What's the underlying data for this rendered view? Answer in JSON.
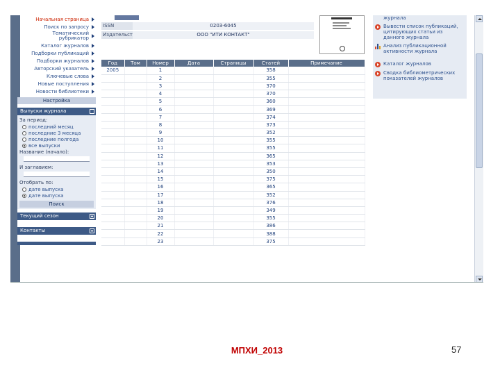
{
  "nav": {
    "links": [
      {
        "label": "Начальная страница",
        "two": false
      },
      {
        "label": "Поиск по запросу",
        "two": false
      },
      {
        "label": "Тематический рубрикатор",
        "two": true
      },
      {
        "label": "Каталог журналов",
        "two": false
      },
      {
        "label": "Подборки публикаций",
        "two": false
      },
      {
        "label": "Подборки журналов",
        "two": false
      },
      {
        "label": "Авторский указатель",
        "two": false
      },
      {
        "label": "Ключевые слова",
        "two": false
      },
      {
        "label": "Новые поступления",
        "two": false
      },
      {
        "label": "Новости библиотеки",
        "two": false
      }
    ],
    "settings_button": "Настройка"
  },
  "issues_panel": {
    "title": "Выпуски журнала",
    "period_label": "За период:",
    "period_options": [
      "последний месяц",
      "последние 3 месяца",
      "последние полгода",
      "все выпуски"
    ],
    "period_selected": 3,
    "name_label": "Название (начало):",
    "name2_label": "И заглавием:",
    "sort_label": "Отобрать по:",
    "sort_options": [
      "дате выпуска",
      "дате выпуска"
    ],
    "sort_selected": 1,
    "search_button": "Поиск"
  },
  "current_issue_panel": {
    "title": "Текущий сезон"
  },
  "contacts_panel": {
    "title": "Контакты"
  },
  "journal_info": {
    "issn_label": "ISSN",
    "issn_value": "0203-6045",
    "publisher_label": "Издательство",
    "publisher_value": "ООО \"ИТИ КОНТАКТ\""
  },
  "issues_table": {
    "columns": [
      "Год",
      "Том",
      "Номер",
      "Дата",
      "Страницы",
      "Статей",
      "Примечание"
    ],
    "rows": [
      {
        "year": "2005",
        "num": "1",
        "articles": "358"
      },
      {
        "year": "",
        "num": "2",
        "articles": "355"
      },
      {
        "year": "",
        "num": "3",
        "articles": "370"
      },
      {
        "year": "",
        "num": "4",
        "articles": "370"
      },
      {
        "year": "",
        "num": "5",
        "articles": "360"
      },
      {
        "year": "",
        "num": "6",
        "articles": "369"
      },
      {
        "year": "",
        "num": "7",
        "articles": "374"
      },
      {
        "year": "",
        "num": "8",
        "articles": "373"
      },
      {
        "year": "",
        "num": "9",
        "articles": "352"
      },
      {
        "year": "",
        "num": "10",
        "articles": "355"
      },
      {
        "year": "",
        "num": "11",
        "articles": "355"
      },
      {
        "year": "",
        "num": "12",
        "articles": "365"
      },
      {
        "year": "",
        "num": "13",
        "articles": "353"
      },
      {
        "year": "",
        "num": "14",
        "articles": "350"
      },
      {
        "year": "",
        "num": "15",
        "articles": "375"
      },
      {
        "year": "",
        "num": "16",
        "articles": "365"
      },
      {
        "year": "",
        "num": "17",
        "articles": "352"
      },
      {
        "year": "",
        "num": "18",
        "articles": "376"
      },
      {
        "year": "",
        "num": "19",
        "articles": "349"
      },
      {
        "year": "",
        "num": "20",
        "articles": "355"
      },
      {
        "year": "",
        "num": "21",
        "articles": "386"
      },
      {
        "year": "",
        "num": "22",
        "articles": "388"
      },
      {
        "year": "",
        "num": "23",
        "articles": "375"
      }
    ]
  },
  "right_links": [
    {
      "label": "журнала",
      "icon": "none"
    },
    {
      "label": "Вывести список публикаций, цитирующих статьи из данного журнала",
      "icon": "arrow"
    },
    {
      "label": "Анализ публикационной активности журнала",
      "icon": "chart"
    },
    {
      "label": "Каталог журналов",
      "icon": "arrow"
    },
    {
      "label": "Сводка библиометрических показателей журналов",
      "icon": "arrow"
    }
  ],
  "footer": {
    "title": "МПХИ_2013",
    "page_number": "57"
  },
  "colors": {
    "accent": "#5a6e8a",
    "link": "#2b4f8c",
    "footer_title": "#c00000",
    "panel_bg": "#e7ecf4"
  }
}
